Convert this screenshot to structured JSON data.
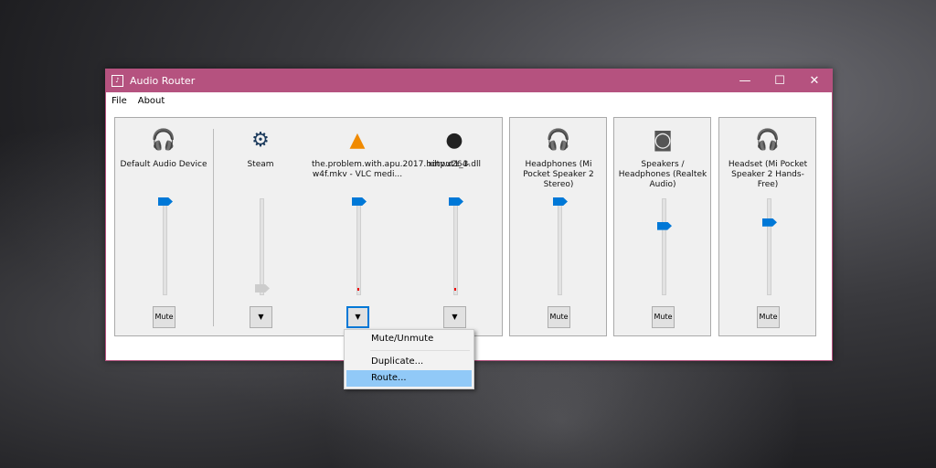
{
  "window": {
    "title": "Audio Router",
    "minimize": "—",
    "maximize": "☐",
    "close": "✕",
    "icon": "app-icon"
  },
  "menu": [
    "File",
    "About"
  ],
  "channels": [
    {
      "name": "Default Audio Device",
      "icon": "headphones-icon",
      "glyph": "🎧",
      "volume": 1.0,
      "muted": false,
      "button": "Mute"
    },
    {
      "name": "Steam",
      "icon": "steam-icon",
      "glyph": "⚙",
      "volume": 0.0,
      "disabled": true,
      "button": "▼"
    },
    {
      "name": "the.problem.with.apu.2017.hdtv.x264-w4f.mkv - VLC medi...",
      "icon": "vlc-cone-icon",
      "glyph": "▲",
      "volume": 1.0,
      "button": "▼",
      "focused": true
    },
    {
      "name": "xinput1_3.dll",
      "icon": "app-thumbnail-icon",
      "glyph": "●",
      "volume": 1.0,
      "button": "▼"
    }
  ],
  "devices": [
    {
      "name": "Headphones (Mi Pocket Speaker 2 Stereo)",
      "icon": "headphones-icon",
      "glyph": "🎧",
      "volume": 1.0,
      "button": "Mute"
    },
    {
      "name": "Speakers / Headphones (Realtek Audio)",
      "icon": "speaker-icon",
      "glyph": "◙",
      "volume": 0.72,
      "button": "Mute"
    },
    {
      "name": "Headset (Mi Pocket Speaker 2 Hands-Free)",
      "icon": "headset-icon",
      "glyph": "🎧",
      "volume": 0.76,
      "button": "Mute"
    }
  ],
  "context_menu": {
    "items": [
      "Mute/Unmute",
      "Duplicate...",
      "Route..."
    ],
    "highlighted": "Route..."
  }
}
